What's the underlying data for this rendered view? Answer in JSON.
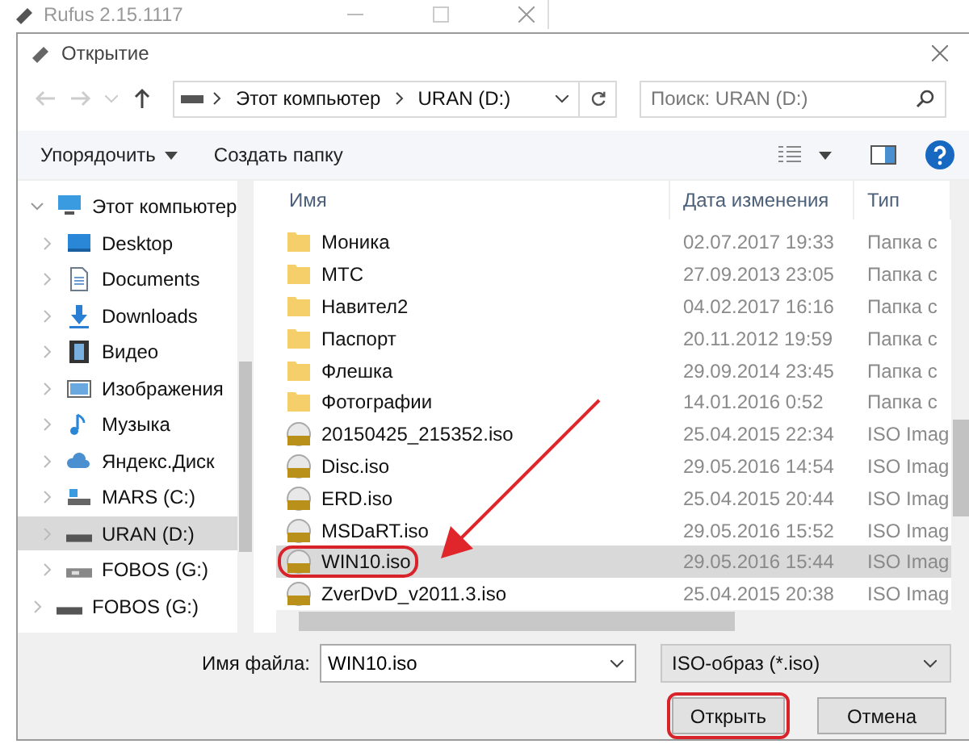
{
  "background_window": {
    "title": "Rufus 2.15.1117"
  },
  "dialog": {
    "title": "Открытие"
  },
  "address": {
    "path": [
      "Этот компьютер",
      "URAN (D:)"
    ]
  },
  "search": {
    "placeholder": "Поиск: URAN (D:)"
  },
  "toolbar": {
    "organize": "Упорядочить",
    "new_folder": "Создать папку"
  },
  "nav": [
    {
      "label": "Этот компьютер",
      "kind": "computer",
      "expanded": true,
      "selected": false,
      "children": [
        {
          "label": "Desktop",
          "kind": "desktop",
          "expanded": false,
          "selected": false
        },
        {
          "label": "Documents",
          "kind": "documents",
          "expanded": false,
          "selected": false
        },
        {
          "label": "Downloads",
          "kind": "downloads",
          "expanded": false,
          "selected": false
        },
        {
          "label": "Видео",
          "kind": "video",
          "expanded": false,
          "selected": false
        },
        {
          "label": "Изображения",
          "kind": "pictures",
          "expanded": false,
          "selected": false
        },
        {
          "label": "Музыка",
          "kind": "music",
          "expanded": false,
          "selected": false
        },
        {
          "label": "Яндекс.Диск",
          "kind": "cloud",
          "expanded": false,
          "selected": false
        },
        {
          "label": "MARS (C:)",
          "kind": "system-drive",
          "expanded": false,
          "selected": false
        },
        {
          "label": "URAN (D:)",
          "kind": "drive",
          "expanded": false,
          "selected": true
        },
        {
          "label": "FOBOS (G:)",
          "kind": "usb",
          "expanded": false,
          "selected": false
        }
      ]
    },
    {
      "label": "FOBOS (G:)",
      "kind": "drive",
      "expanded": false,
      "selected": false
    }
  ],
  "columns": [
    "Имя",
    "Дата изменения",
    "Тип"
  ],
  "files": [
    {
      "kind": "folder",
      "name": "Моника",
      "date": "02.07.2017 19:33",
      "type": "Папка с",
      "selected": false,
      "circled": false
    },
    {
      "kind": "folder",
      "name": "МТС",
      "date": "27.09.2013 23:05",
      "type": "Папка с",
      "selected": false,
      "circled": false
    },
    {
      "kind": "folder",
      "name": "Навител2",
      "date": "04.02.2017 16:16",
      "type": "Папка с",
      "selected": false,
      "circled": false
    },
    {
      "kind": "folder",
      "name": "Паспорт",
      "date": "20.11.2012 19:59",
      "type": "Папка с",
      "selected": false,
      "circled": false
    },
    {
      "kind": "folder",
      "name": "Флешка",
      "date": "29.09.2014 23:45",
      "type": "Папка с",
      "selected": false,
      "circled": false
    },
    {
      "kind": "folder",
      "name": "Фотографии",
      "date": "14.01.2016 0:52",
      "type": "Папка с",
      "selected": false,
      "circled": false
    },
    {
      "kind": "iso",
      "name": "20150425_215352.iso",
      "date": "25.04.2015 22:34",
      "type": "ISO Imag",
      "selected": false,
      "circled": false
    },
    {
      "kind": "iso",
      "name": "Disc.iso",
      "date": "29.05.2016 14:54",
      "type": "ISO Imag",
      "selected": false,
      "circled": false
    },
    {
      "kind": "iso",
      "name": "ERD.iso",
      "date": "25.04.2015 20:44",
      "type": "ISO Imag",
      "selected": false,
      "circled": false
    },
    {
      "kind": "iso",
      "name": "MSDaRT.iso",
      "date": "29.05.2016 15:52",
      "type": "ISO Imag",
      "selected": false,
      "circled": false
    },
    {
      "kind": "iso",
      "name": "WIN10.iso",
      "date": "29.05.2016 15:44",
      "type": "ISO Imag",
      "selected": true,
      "circled": true
    },
    {
      "kind": "iso",
      "name": "ZverDvD_v2011.3.iso",
      "date": "25.04.2015 20:38",
      "type": "ISO Imag",
      "selected": false,
      "circled": false
    }
  ],
  "filename": {
    "label": "Имя файла:",
    "value": "WIN10.iso"
  },
  "filter": {
    "value": "ISO-образ (*.iso)"
  },
  "buttons": [
    {
      "label": "Открыть",
      "circled": true
    },
    {
      "label": "Отмена",
      "circled": false
    }
  ]
}
